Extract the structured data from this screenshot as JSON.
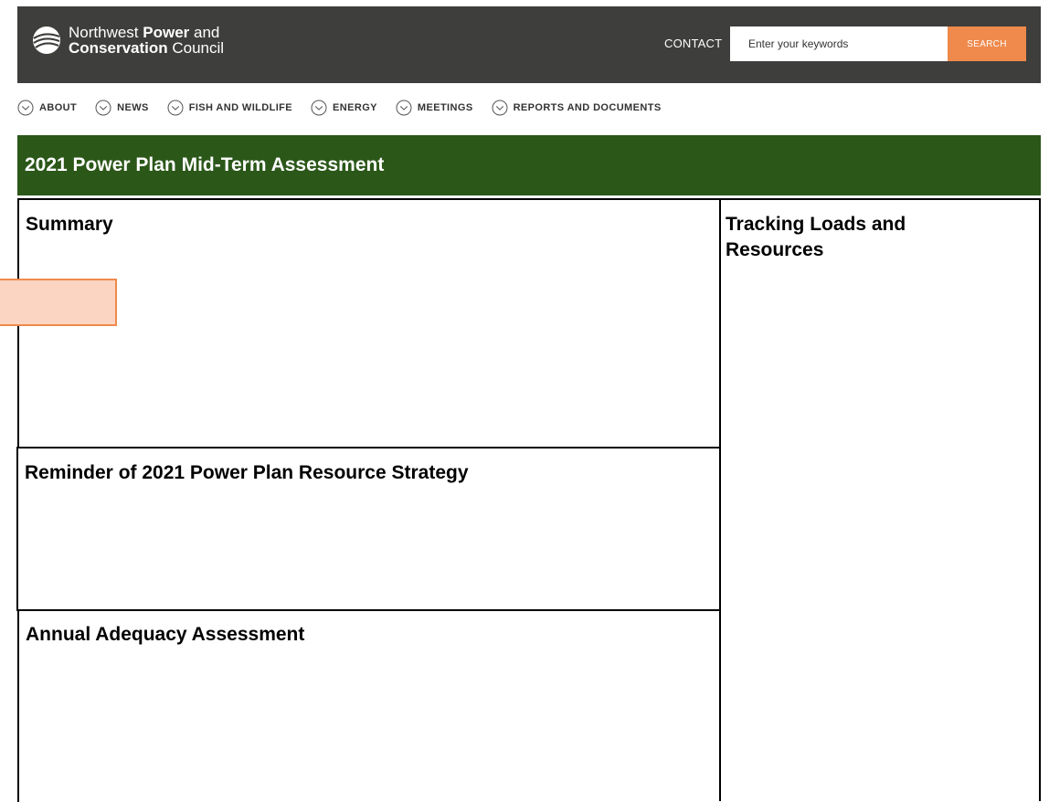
{
  "header": {
    "logo": {
      "line1_regular": "Northwest ",
      "line1_bold": "Power",
      "line1_suffix": " and",
      "line2_bold": "Conservation",
      "line2_suffix": " Council"
    },
    "contact_label": "CONTACT",
    "search": {
      "placeholder": "Enter your keywords",
      "value": "",
      "button_label": "SEARCH"
    }
  },
  "nav": {
    "icon": "chevron-circle-icon",
    "items": [
      {
        "label": "ABOUT"
      },
      {
        "label": "NEWS"
      },
      {
        "label": "FISH AND WILDLIFE"
      },
      {
        "label": "ENERGY"
      },
      {
        "label": "MEETINGS"
      },
      {
        "label": "REPORTS AND DOCUMENTS"
      }
    ]
  },
  "banner": {
    "title": "2021 Power Plan Mid-Term Assessment"
  },
  "sections": {
    "summary": {
      "title": "Summary"
    },
    "reminder": {
      "title": "Reminder of 2021 Power Plan Resource Strategy"
    },
    "annual": {
      "title": "Annual Adequacy Assessment"
    },
    "tracking": {
      "title": "Tracking Loads and Resources"
    }
  },
  "colors": {
    "header_bg": "#3e3e3c",
    "accent_orange": "#ef8a4c",
    "banner_green": "#2b5719",
    "highlight_fill": "#fbd5c1"
  }
}
